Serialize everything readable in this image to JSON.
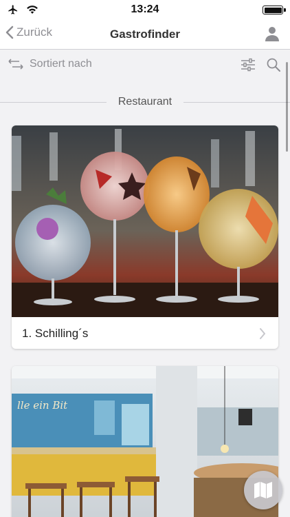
{
  "status_bar": {
    "time": "13:24",
    "icons": [
      "airplane-icon",
      "wifi-icon",
      "battery-icon"
    ]
  },
  "nav": {
    "back_label": "Zurück",
    "title": "Gastrofinder",
    "user_icon": "user-icon"
  },
  "toolbar": {
    "sort_label": "Sortiert nach",
    "sort_icon": "swap-arrows-icon",
    "filter_icon": "sliders-icon",
    "search_icon": "search-icon"
  },
  "section": {
    "label": "Restaurant"
  },
  "restaurants": [
    {
      "name": "1. Schilling´s",
      "image": "cocktail-glasses-photo"
    },
    {
      "name": "",
      "image": "restaurant-interior-photo"
    }
  ],
  "map_button": {
    "icon": "map-icon"
  },
  "colors": {
    "accent_gray": "#8e8e93",
    "background": "#f2f2f4",
    "card": "#ffffff"
  }
}
